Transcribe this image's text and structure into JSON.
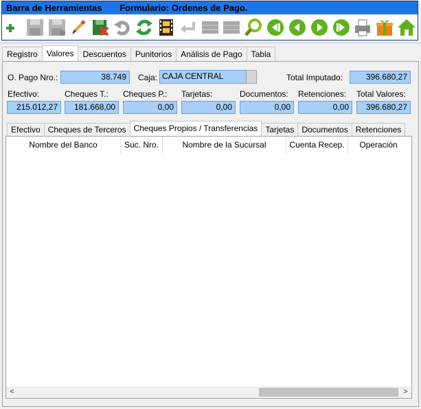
{
  "toolbar": {
    "title_left": "Barra de Herramientas",
    "title_right": "Formulario: Ordenes de Pago.",
    "colors": {
      "frame": "#1c74e9",
      "strip": "#ffffff"
    },
    "buttons": [
      {
        "icon": "add-icon"
      },
      {
        "icon": "save-icon"
      },
      {
        "icon": "save-as-icon"
      },
      {
        "icon": "edit-pencil-icon"
      },
      {
        "icon": "delete-icon"
      },
      {
        "icon": "undo-icon"
      },
      {
        "icon": "refresh-icon"
      },
      {
        "icon": "film-icon"
      },
      {
        "icon": "return-icon"
      },
      {
        "icon": "grid-icon"
      },
      {
        "icon": "grid-alt-icon"
      },
      {
        "icon": "search-icon"
      },
      {
        "icon": "first-record-icon"
      },
      {
        "icon": "prev-record-icon"
      },
      {
        "icon": "next-record-icon"
      },
      {
        "icon": "last-record-icon"
      },
      {
        "icon": "printer-icon"
      },
      {
        "icon": "gift-icon"
      },
      {
        "icon": "home-icon"
      }
    ]
  },
  "main_tabs": [
    "Registro",
    "Valores",
    "Descuentos",
    "Punitorios",
    "Análisis de Pago",
    "Tabla"
  ],
  "active_main_tab": "Valores",
  "header": {
    "opago_label": "O. Pago Nro.:",
    "opago_value": "38.749",
    "caja_label": "Caja:",
    "caja_value": "CAJA CENTRAL",
    "total_imputado_label": "Total Imputado:",
    "total_imputado_value": "396.680,27"
  },
  "values": {
    "efectivo_label": "Efectivo:",
    "efectivo_value": "215.012,27",
    "cheques_t_label": "Cheques T.:",
    "cheques_t_value": "181.668,00",
    "cheques_p_label": "Cheques P.:",
    "cheques_p_value": "0,00",
    "tarjetas_label": "Tarjetas:",
    "tarjetas_value": "0,00",
    "documentos_label": "Documentos:",
    "documentos_value": "0,00",
    "retenciones_label": "Retenciones:",
    "retenciones_value": "0,00",
    "total_valores_label": "Total Valores:",
    "total_valores_value": "396.680,27"
  },
  "sub_tabs": [
    "Efectivo",
    "Cheques de Terceros",
    "Cheques Propios / Transferencias",
    "Tarjetas",
    "Documentos",
    "Retenciones"
  ],
  "active_sub_tab": "Cheques Propios / Transferencias",
  "grid": {
    "columns": [
      "Nombre del Banco",
      "Suc. Nro.",
      "Nombre de la Sucursal",
      "Cuenta Recep.",
      "Operación"
    ],
    "rows": []
  },
  "scrollbar": {
    "left_arrow": "<",
    "right_arrow": ">"
  }
}
